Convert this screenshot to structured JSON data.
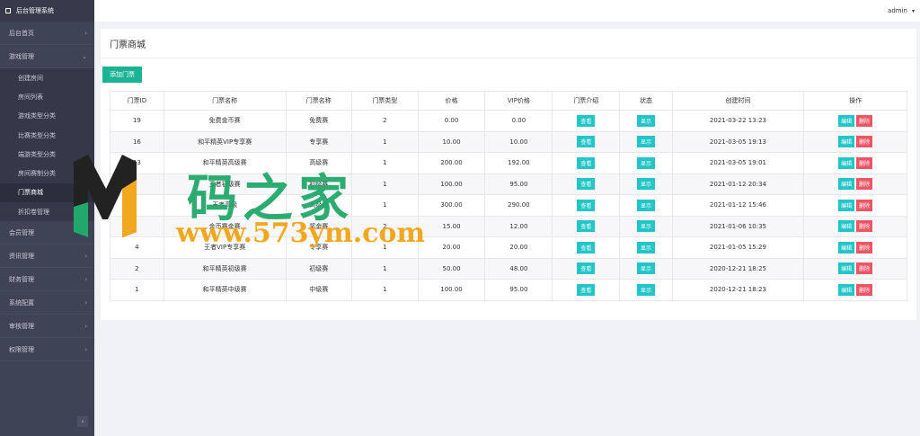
{
  "sidebar": {
    "brand": "后台管理系统",
    "menu_top": [
      {
        "label": "后台首页",
        "arrow": "›"
      },
      {
        "label": "游戏管理",
        "arrow": "⌄"
      }
    ],
    "submenu": [
      {
        "label": "创建房间"
      },
      {
        "label": "房间列表"
      },
      {
        "label": "游戏类型分类"
      },
      {
        "label": "比赛类型分类"
      },
      {
        "label": "端游类型分类"
      },
      {
        "label": "房间赛制分类"
      },
      {
        "label": "门票商城"
      },
      {
        "label": "折扣卷管理"
      }
    ],
    "menu_bottom": [
      {
        "label": "会员管理",
        "arrow": "›"
      },
      {
        "label": "资讯管理",
        "arrow": "›"
      },
      {
        "label": "财务管理",
        "arrow": "›"
      },
      {
        "label": "系统配置",
        "arrow": "›"
      },
      {
        "label": "审核管理",
        "arrow": "›"
      },
      {
        "label": "权限管理",
        "arrow": "›"
      }
    ],
    "collapse": "‹"
  },
  "topbar": {
    "user": "admin",
    "caret": "▾"
  },
  "panel": {
    "title": "门票商城",
    "add_button": "添加门票",
    "columns": [
      "门票ID",
      "门票名称",
      "门票名称",
      "门票类型",
      "价格",
      "VIP价格",
      "门票介绍",
      "状态",
      "创建时间",
      "操作"
    ],
    "rows": [
      {
        "id": "19",
        "name": "免费金币赛",
        "level": "免费赛",
        "type": "2",
        "price": "0.00",
        "vip": "0.00",
        "time": "2021-03-22 13:23"
      },
      {
        "id": "16",
        "name": "和平精英VIP专享赛",
        "level": "专享赛",
        "type": "1",
        "price": "10.00",
        "vip": "10.00",
        "time": "2021-03-05 19:13"
      },
      {
        "id": "13",
        "name": "和平精英高级赛",
        "level": "高级赛",
        "type": "1",
        "price": "200.00",
        "vip": "192.00",
        "time": "2021-03-05 19:01"
      },
      {
        "id": "",
        "name": "王者初级赛",
        "level": "初级赛",
        "type": "1",
        "price": "100.00",
        "vip": "95.00",
        "time": "2021-01-12 20:34"
      },
      {
        "id": "",
        "name": "王者高级",
        "level": "高级赛",
        "type": "1",
        "price": "300.00",
        "vip": "290.00",
        "time": "2021-01-12 15:46"
      },
      {
        "id": "",
        "name": "金币赛金赛",
        "level": "奖金赛",
        "type": "2",
        "price": "15.00",
        "vip": "12.00",
        "time": "2021-01-06 10:35"
      },
      {
        "id": "4",
        "name": "王者VIP专享赛",
        "level": "专享赛",
        "type": "1",
        "price": "20.00",
        "vip": "20.00",
        "time": "2021-01-05 15:29"
      },
      {
        "id": "2",
        "name": "和平精英初级赛",
        "level": "初级赛",
        "type": "1",
        "price": "50.00",
        "vip": "48.00",
        "time": "2020-12-21 18:25"
      },
      {
        "id": "1",
        "name": "和平精英中级赛",
        "level": "中级赛",
        "type": "1",
        "price": "100.00",
        "vip": "95.00",
        "time": "2020-12-21 18:23"
      }
    ],
    "view_label": "查看",
    "status_label": "显示",
    "edit_label": "编辑",
    "delete_label": "删除"
  },
  "watermark": {
    "title": "码之家",
    "url": "www.573ym.com"
  },
  "colors": {
    "sidebar": "#3e4355",
    "primary": "#1ab394",
    "info": "#23c6c8",
    "danger": "#ed5565"
  }
}
